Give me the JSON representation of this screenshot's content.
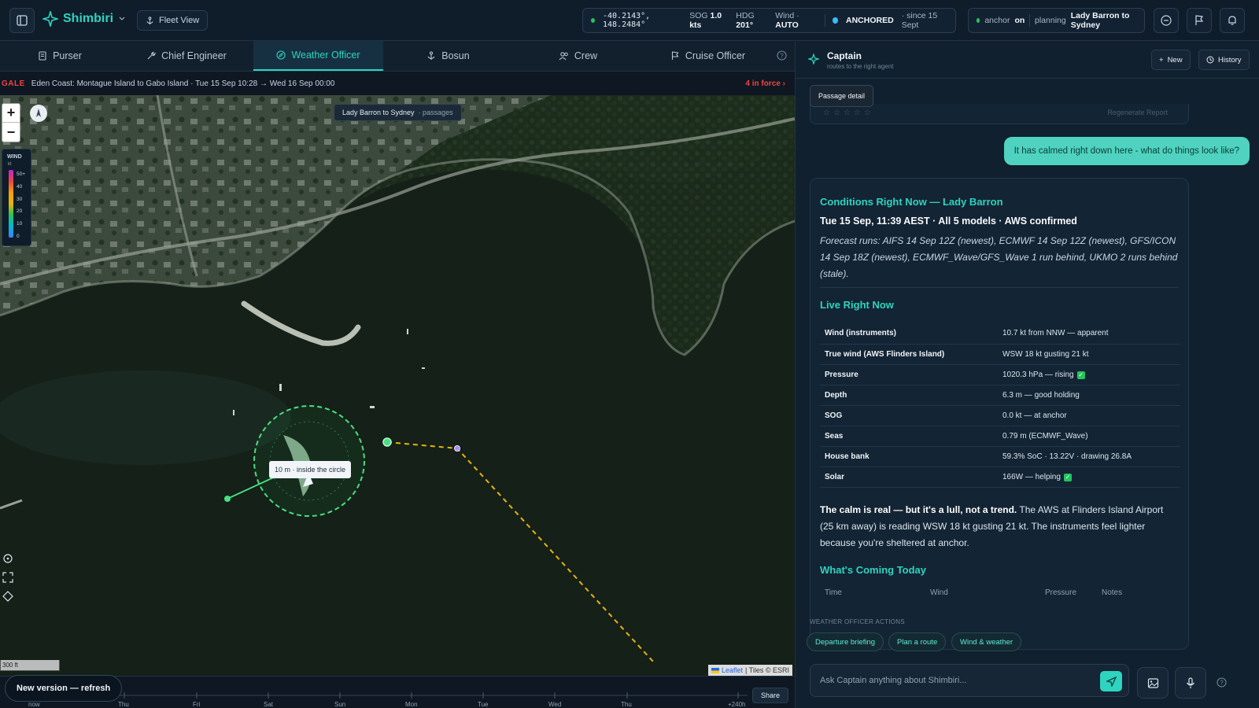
{
  "app": {
    "name": "Shimbiri",
    "fleet_label": "Fleet View"
  },
  "status": {
    "coords": "-40.2143°, 148.2484°",
    "sog_label": "SOG",
    "sog": "1.0 kts",
    "hdg_label": "HDG",
    "hdg": "201°",
    "wind_label": "Wind",
    "wind": "AUTO",
    "state": "ANCHORED",
    "since": "since 15 Sept"
  },
  "plan": {
    "anchor_label": "anchor",
    "anchor_state": "on",
    "planning_label": "planning",
    "route": "Lady Barron to Sydney"
  },
  "tabs": [
    {
      "label": "Purser"
    },
    {
      "label": "Chief Engineer"
    },
    {
      "label": "Weather Officer"
    },
    {
      "label": "Bosun"
    },
    {
      "label": "Crew"
    },
    {
      "label": "Cruise Officer"
    }
  ],
  "gale": {
    "label": "GALE",
    "text": "Eden Coast: Montague Island to Gabo Island · Tue 15 Sep 10:28 → Wed 16 Sep 00:00",
    "count": "4 in force"
  },
  "map": {
    "route_label": "Lady Barron to Sydney",
    "route_sub": "· passages",
    "anchor_tip": "10 m · inside the circle",
    "scale": "300 ft",
    "attr_leaflet": "Leaflet",
    "attr_tiles": "| Tiles © ESRI",
    "wind_legend": {
      "title": "WIND",
      "unit": "kt",
      "ticks": [
        "50+",
        "40",
        "30",
        "20",
        "10",
        "0"
      ]
    }
  },
  "timeline": {
    "labels": [
      "now",
      "Thu",
      "Fri",
      "Sat",
      "Sun",
      "Mon",
      "Tue",
      "Wed",
      "Thu",
      "+240h"
    ],
    "share": "Share",
    "fragment": "T"
  },
  "toast": "New version — refresh",
  "chat": {
    "title": "Captain",
    "subtitle": "routes to the right agent",
    "new_label": "New",
    "history_label": "History",
    "tooltip": "Passage detail",
    "prev_actions": "Regenerate   Report",
    "user_message": "It has calmed right down here - what do things look like?",
    "answer": {
      "title": "Conditions Right Now — Lady Barron",
      "subtitle": "Tue 15 Sep, 11:39 AEST · All 5 models · AWS confirmed",
      "forecast_runs": "Forecast runs: AIFS 14 Sep 12Z (newest), ECMWF 14 Sep 12Z (newest), GFS/ICON 14 Sep 18Z (newest), ECMWF_Wave/GFS_Wave 1 run behind, UKMO 2 runs behind (stale).",
      "live_title": "Live Right Now",
      "rows": [
        {
          "k": "Wind (instruments)",
          "v": "10.7 kt from NNW — apparent"
        },
        {
          "k": "True wind (AWS Flinders Island)",
          "v": "WSW 18 kt gusting 21 kt"
        },
        {
          "k": "Pressure",
          "v": "1020.3 hPa — rising"
        },
        {
          "k": "Depth",
          "v": "6.3 m — good holding"
        },
        {
          "k": "SOG",
          "v": "0.0 kt — at anchor"
        },
        {
          "k": "Seas",
          "v": "0.79 m (ECMWF_Wave)"
        },
        {
          "k": "House bank",
          "v": "59.3% SoC · 13.22V · drawing 26.8A"
        },
        {
          "k": "Solar",
          "v": "166W — helping"
        }
      ],
      "calm_bold": "The calm is real — but it's a lull, not a trend.",
      "calm_text": " The AWS at Flinders Island Airport (25 km away) is reading WSW 18 kt gusting 21 kt. The instruments feel lighter because you're sheltered at anchor.",
      "today_title": "What's Coming Today",
      "today_cols": [
        "Time",
        "Wind",
        "Pressure",
        "Notes"
      ]
    },
    "actions_label": "WEATHER OFFICER ACTIONS",
    "actions": [
      "Departure briefing",
      "Plan a route",
      "Wind & weather"
    ],
    "composer_placeholder": "Ask Captain anything about Shimbiri..."
  }
}
